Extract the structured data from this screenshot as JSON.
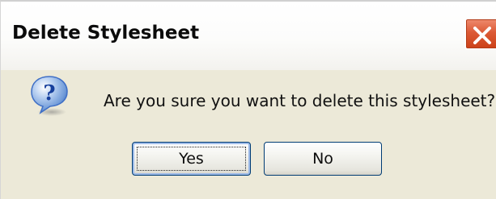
{
  "dialog": {
    "title": "Delete Stylesheet",
    "message": "Are you sure you want to delete this stylesheet?",
    "question_glyph": "?",
    "yes_label": "Yes",
    "no_label": "No"
  },
  "icons": {
    "close": "close-icon",
    "question": "question-icon"
  },
  "colors": {
    "close_button": "#d9532f",
    "dialog_body": "#ece9d8",
    "question_icon": "#2e63c4",
    "button_border": "#003c74"
  }
}
